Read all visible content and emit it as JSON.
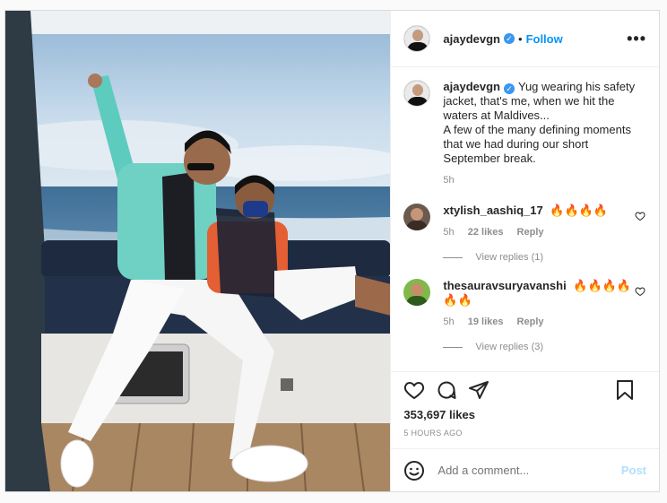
{
  "post": {
    "author": "ajaydevgn",
    "follow_label": "Follow",
    "separator": "•",
    "more_label": "•••",
    "caption_lines": [
      "Yug wearing his safety jacket, that's me, when we hit the waters at Maldives...",
      "A few of the many defining moments that we had during our short September break."
    ],
    "caption_age": "5h",
    "likes": "353,697 likes",
    "timestamp": "5 HOURS AGO"
  },
  "comments": [
    {
      "user": "xtylish_aashiq_17",
      "text": "🔥🔥🔥🔥",
      "age": "5h",
      "likes": "22 likes",
      "reply_label": "Reply",
      "view_replies": "View replies (1)"
    },
    {
      "user": "thesauravsuryavanshi",
      "text": "🔥🔥🔥🔥🔥🔥",
      "age": "5h",
      "likes": "19 likes",
      "reply_label": "Reply",
      "view_replies": "View replies (3)"
    }
  ],
  "add_comment": {
    "placeholder": "Add a comment...",
    "post_label": "Post"
  },
  "icons": {
    "verified": "verified-badge-icon",
    "like": "heart-icon",
    "comment": "comment-bubble-icon",
    "share": "paper-plane-icon",
    "save": "bookmark-icon",
    "emoji": "smiley-icon"
  },
  "colors": {
    "link_blue": "#0095f6",
    "verified_blue": "#3897f0",
    "muted_text": "#8e8e8e",
    "post_disabled": "#b2dffc"
  }
}
